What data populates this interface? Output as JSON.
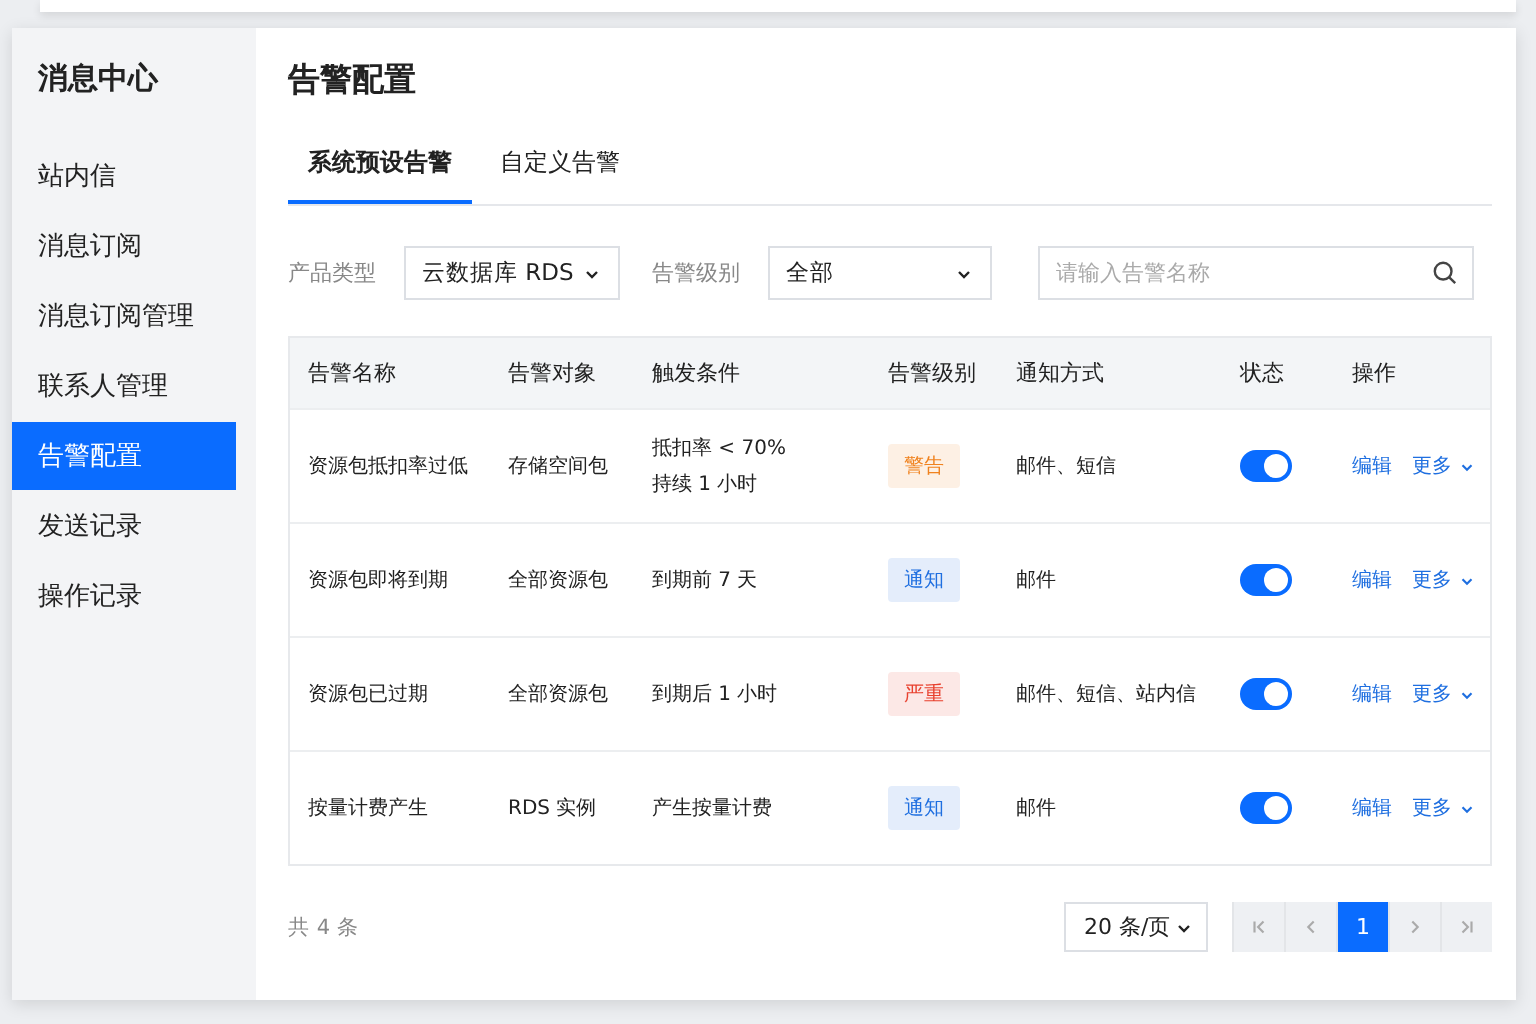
{
  "sidebar": {
    "title": "消息中心",
    "items": [
      {
        "label": "站内信",
        "selected": false
      },
      {
        "label": "消息订阅",
        "selected": false
      },
      {
        "label": "消息订阅管理",
        "selected": false
      },
      {
        "label": "联系人管理",
        "selected": false
      },
      {
        "label": "告警配置",
        "selected": true
      },
      {
        "label": "发送记录",
        "selected": false
      },
      {
        "label": "操作记录",
        "selected": false
      }
    ]
  },
  "page": {
    "title": "告警配置"
  },
  "tabs": [
    {
      "label": "系统预设告警",
      "selected": true
    },
    {
      "label": "自定义告警",
      "selected": false
    }
  ],
  "filters": {
    "product_label": "产品类型",
    "product_value": "云数据库 RDS",
    "level_label": "告警级别",
    "level_value": "全部",
    "search": {
      "placeholder": "请输入告警名称"
    }
  },
  "table": {
    "columns": [
      "告警名称",
      "告警对象",
      "触发条件",
      "告警级别",
      "通知方式",
      "状态",
      "操作"
    ],
    "rows": [
      {
        "name": "资源包抵扣率过低",
        "target": "存储空间包",
        "condition": [
          "抵扣率 < 70%",
          "持续 1 小时"
        ],
        "level": "警告",
        "color": "#f0821e",
        "notify": "邮件、短信",
        "on": true,
        "edit": "编辑",
        "more": "更多"
      },
      {
        "name": "资源包即将到期",
        "target": "全部资源包",
        "condition": [
          "到期前 7 天"
        ],
        "level": "通知",
        "color": "#1f6fe0",
        "notify": "邮件",
        "on": true,
        "edit": "编辑",
        "more": "更多"
      },
      {
        "name": "资源包已过期",
        "target": "全部资源包",
        "condition": [
          "到期后 1 小时"
        ],
        "level": "严重",
        "color": "#e8412f",
        "notify": "邮件、短信、站内信",
        "on": true,
        "edit": "编辑",
        "more": "更多"
      },
      {
        "name": "按量计费产生",
        "target": "RDS 实例",
        "condition": [
          "产生按量计费"
        ],
        "level": "通知",
        "color": "#1f6fe0",
        "notify": "邮件",
        "on": true,
        "edit": "编辑",
        "more": "更多"
      }
    ]
  },
  "footer": {
    "total": "共 4 条",
    "page_size": "20 条/页",
    "pages": [
      {
        "label": "1",
        "selected": true
      }
    ]
  }
}
